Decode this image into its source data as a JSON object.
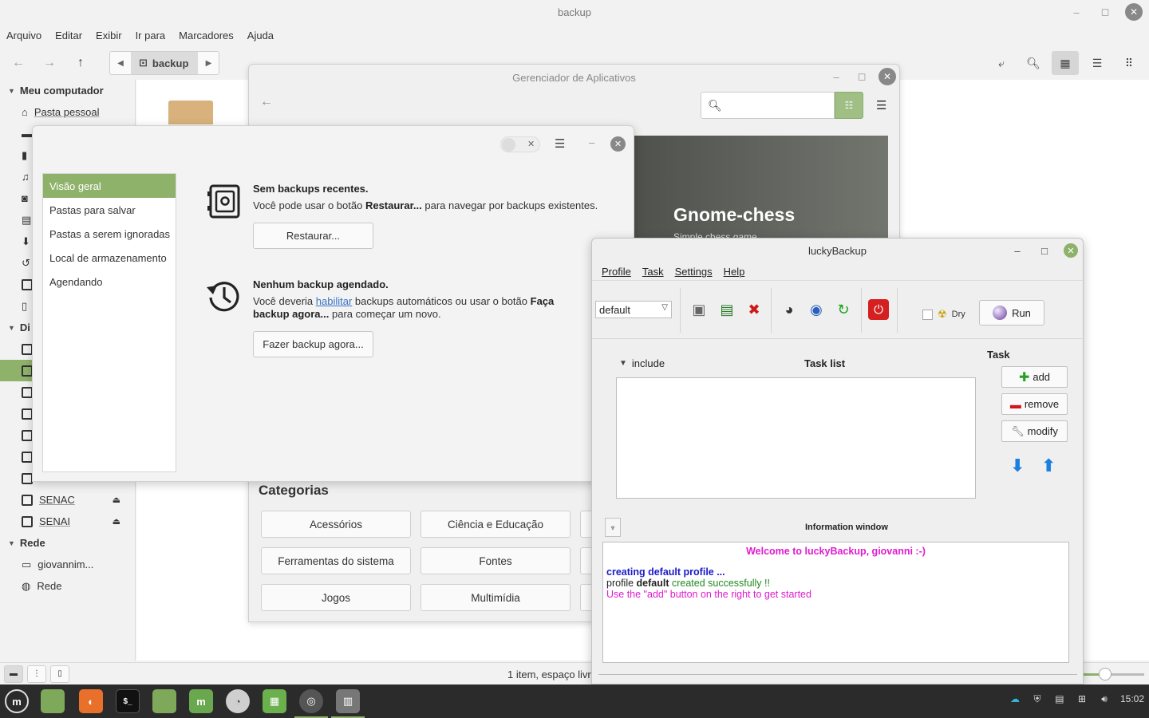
{
  "file_manager": {
    "title": "backup",
    "menu": [
      "Arquivo",
      "Editar",
      "Exibir",
      "Ir para",
      "Marcadores",
      "Ajuda"
    ],
    "path_crumb": "backup",
    "sidebar": {
      "section_computer": "Meu computador",
      "home": "Pasta pessoal",
      "section_devices": "Di",
      "senac": "SENAC",
      "senai": "SENAI",
      "section_network": "Rede",
      "net_user": "giovannim...",
      "net": "Rede"
    },
    "status_text": "1 item, espaço livr",
    "zoom_level": 0.3
  },
  "software_manager": {
    "title": "Gerenciador de Aplicativos",
    "banner_title": "Gnome-chess",
    "banner_subtitle": "Simple chess game",
    "categories_title": "Categorias",
    "categories": [
      "Acessórios",
      "Ciência e Educação",
      "Ferramentas do sistema",
      "Fontes",
      "Jogos",
      "Multimídia"
    ]
  },
  "backup_tool": {
    "sidebar": [
      "Visão geral",
      "Pastas para salvar",
      "Pastas a serem ignoradas",
      "Local de armazenamento",
      "Agendando"
    ],
    "no_recent_title": "Sem backups recentes.",
    "no_recent_pre": "Você pode usar o botão ",
    "no_recent_bold": "Restaurar...",
    "no_recent_post": " para navegar por backups existentes.",
    "restore_button": "Restaurar...",
    "no_schedule_title": "Nenhum backup agendado.",
    "no_schedule_pre": "Você deveria ",
    "no_schedule_link": "habilitar",
    "no_schedule_mid": " backups automáticos ou usar o botão ",
    "no_schedule_bold": "Faça backup agora...",
    "no_schedule_post": " para começar um novo.",
    "backup_now_button": "Fazer backup agora..."
  },
  "luckybackup": {
    "title": "luckyBackup",
    "menu": [
      "Profile",
      "Task",
      "Settings",
      "Help"
    ],
    "profile": "default",
    "dry_label": "Dry",
    "run_label": "Run",
    "include_label": "include",
    "task_list_label": "Task list",
    "task_label": "Task",
    "add_label": "add",
    "remove_label": "remove",
    "modify_label": "modify",
    "info_label": "Information window",
    "info_welcome": "Welcome to luckyBackup, giovanni :-)",
    "info_line1": "creating default profile ...",
    "info_line2_pre": "profile ",
    "info_line2_bold": "default",
    "info_line2_post": " created successfully !!",
    "info_line3": "Use the \"add\" button on the right to get started"
  },
  "taskbar": {
    "clock": "15:02"
  },
  "colors": {
    "accent": "#8fb26b",
    "welcome": "#e01bd0",
    "info_blue": "#1a1ac8",
    "info_green": "#1f8a1f"
  }
}
